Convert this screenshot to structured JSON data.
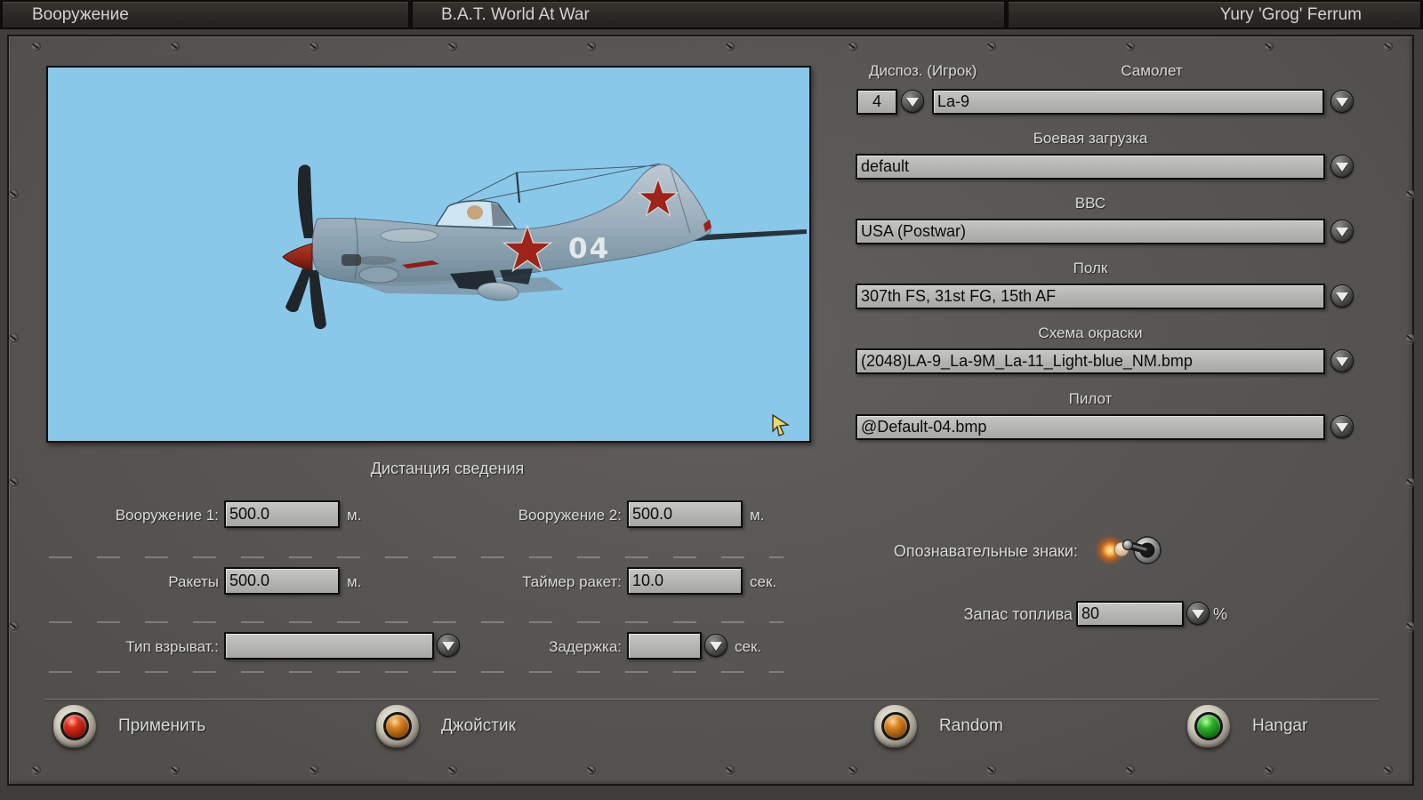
{
  "titlebar": {
    "app_section": "Вооружение",
    "app_title": "B.A.T. World At War",
    "player_name": "Yury 'Grog' Ferrum"
  },
  "preview": {
    "tactical_number": "04",
    "sky_color": "#8ac8ea"
  },
  "right_panel": {
    "position": {
      "label": "Диспоз. (Игрок)",
      "value": "4"
    },
    "aircraft": {
      "label": "Самолет",
      "value": "La-9"
    },
    "loadout": {
      "label": "Боевая загрузка",
      "value": "default"
    },
    "air_force": {
      "label": "ВВС",
      "value": "USA (Postwar)"
    },
    "regiment": {
      "label": "Полк",
      "value": "307th FS, 31st FG, 15th AF"
    },
    "skin": {
      "label": "Схема окраски",
      "value": "(2048)LA-9_La-9M_La-11_Light-blue_NM.bmp"
    },
    "pilot": {
      "label": "Пилот",
      "value": "@Default-04.bmp"
    }
  },
  "convergence": {
    "title": "Дистанция сведения",
    "weapon1": {
      "label": "Вооружение 1:",
      "value": "500.0",
      "unit": "м."
    },
    "weapon2": {
      "label": "Вооружение 2:",
      "value": "500.0",
      "unit": "м."
    },
    "rockets": {
      "label": "Ракеты",
      "value": "500.0",
      "unit": "м."
    },
    "rocket_timer": {
      "label": "Таймер ракет:",
      "value": "10.0",
      "unit": "сек."
    },
    "fuze_type": {
      "label": "Тип взрыват.:",
      "value": ""
    },
    "delay": {
      "label": "Задержка:",
      "value": "",
      "unit": "сек."
    }
  },
  "options": {
    "markings": {
      "label": "Опознавательные знаки:",
      "state": "on"
    },
    "fuel": {
      "label": "Запас топлива",
      "value": "80",
      "unit": "%"
    }
  },
  "footer_buttons": [
    {
      "label": "Применить",
      "led_color": "#c41408"
    },
    {
      "label": "Джойстик",
      "led_color": "#c97a12"
    },
    {
      "label": "Random",
      "led_color": "#c97a12"
    },
    {
      "label": "Hangar",
      "led_color": "#2db82d"
    }
  ]
}
